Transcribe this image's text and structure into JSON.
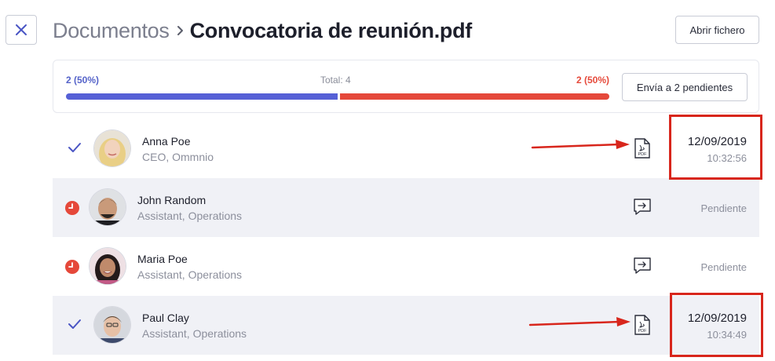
{
  "header": {
    "breadcrumb_root": "Documentos",
    "document_title": "Convocatoria de reunión.pdf",
    "open_file_label": "Abrir fichero"
  },
  "summary": {
    "signed_label": "2 (50%)",
    "total_label": "Total: 4",
    "pending_label": "2 (50%)",
    "signed_fraction": 0.5,
    "send_pending_label": "Envía a 2 pendientes",
    "colors": {
      "signed": "#5660d6",
      "pending": "#e5483a"
    }
  },
  "recipients": [
    {
      "name": "Anna Poe",
      "role": "CEO, Ommnio",
      "status": "signed",
      "status_icon": "check-icon",
      "doc_icon": "pdf-icon",
      "date": "12/09/2019",
      "time": "10:32:56"
    },
    {
      "name": "John Random",
      "role": "Assistant, Operations",
      "status": "pending",
      "status_icon": "clock-icon",
      "doc_icon": "send-message-icon",
      "pending_label": "Pendiente"
    },
    {
      "name": "Maria Poe",
      "role": "Assistant, Operations",
      "status": "pending",
      "status_icon": "clock-icon",
      "doc_icon": "send-message-icon",
      "pending_label": "Pendiente"
    },
    {
      "name": "Paul Clay",
      "role": "Assistant, Operations",
      "status": "signed",
      "status_icon": "check-icon",
      "doc_icon": "pdf-icon",
      "date": "12/09/2019",
      "time": "10:34:49"
    }
  ],
  "annotation_color": "#d8261c"
}
